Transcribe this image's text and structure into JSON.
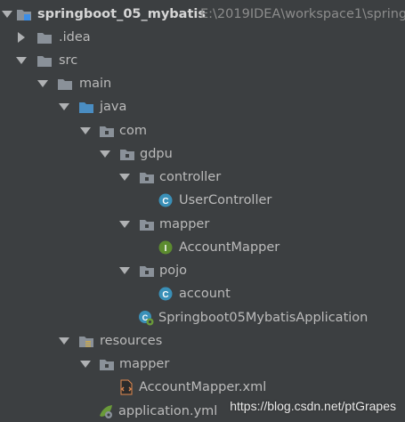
{
  "project": {
    "name": "springboot_05_mybatis",
    "path": "E:\\2019IDEA\\workspace1\\spring"
  },
  "nodes": {
    "idea": ".idea",
    "src": "src",
    "main": "main",
    "java": "java",
    "com": "com",
    "gdpu": "gdpu",
    "controller": "controller",
    "user_controller": "UserController",
    "mapper_pkg": "mapper",
    "account_mapper": "AccountMapper",
    "pojo": "pojo",
    "account": "account",
    "application_class": "Springboot05MybatisApplication",
    "resources": "resources",
    "mapper_res": "mapper",
    "account_mapper_xml": "AccountMapper.xml",
    "application_yml": "application.yml"
  },
  "icons": {
    "class_letter": "C",
    "interface_letter": "I"
  },
  "watermark": "https://blog.csdn.net/ptGrapes",
  "colors": {
    "background": "#3c3f41",
    "text": "#bbbbbb",
    "folder": "#8a9199",
    "source_folder": "#4a8dc2",
    "class_icon": "#3a90b8",
    "interface_icon": "#5c8b2f"
  }
}
